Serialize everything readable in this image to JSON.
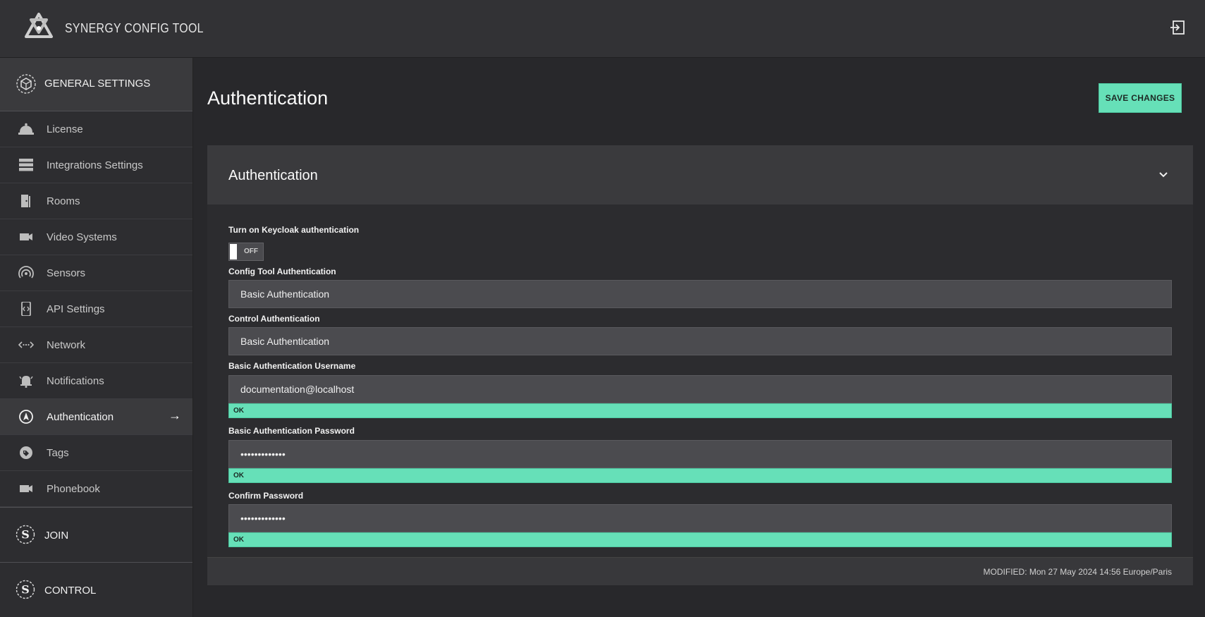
{
  "app": {
    "title": "SYNERGY CONFIG TOOL"
  },
  "sidebar": {
    "section_top": "GENERAL SETTINGS",
    "items": [
      {
        "label": "License",
        "icon": "bell-icon"
      },
      {
        "label": "Integrations Settings",
        "icon": "server-icon"
      },
      {
        "label": "Rooms",
        "icon": "door-icon"
      },
      {
        "label": "Video Systems",
        "icon": "camera-icon"
      },
      {
        "label": "Sensors",
        "icon": "sensor-icon"
      },
      {
        "label": "API Settings",
        "icon": "api-icon"
      },
      {
        "label": "Network",
        "icon": "network-icon"
      },
      {
        "label": "Notifications",
        "icon": "alarm-icon"
      },
      {
        "label": "Authentication",
        "icon": "compass-icon",
        "active": true,
        "arrow": "→"
      },
      {
        "label": "Tags",
        "icon": "tag-icon"
      },
      {
        "label": "Phonebook",
        "icon": "camera-icon"
      }
    ],
    "section_join": "JOIN",
    "section_control": "CONTROL"
  },
  "main": {
    "title": "Authentication",
    "save_label": "SAVE CHANGES",
    "card": {
      "title": "Authentication",
      "keycloak_label": "Turn on Keycloak authentication",
      "keycloak_state": "OFF",
      "config_auth_label": "Config Tool Authentication",
      "config_auth_value": "Basic Authentication",
      "control_auth_label": "Control Authentication",
      "control_auth_value": "Basic Authentication",
      "username_label": "Basic Authentication Username",
      "username_value": "documentation@localhost",
      "username_status": "OK",
      "password_label": "Basic Authentication Password",
      "password_value": "•••••••••••••",
      "password_status": "OK",
      "confirm_label": "Confirm Password",
      "confirm_value": "•••••••••••••",
      "confirm_status": "OK",
      "modified": "MODIFIED: Mon 27 May 2024 14:56 Europe/Paris"
    }
  },
  "colors": {
    "accent": "#66e0b8",
    "background": "#28282b",
    "sidebar": "#2d2d30"
  }
}
